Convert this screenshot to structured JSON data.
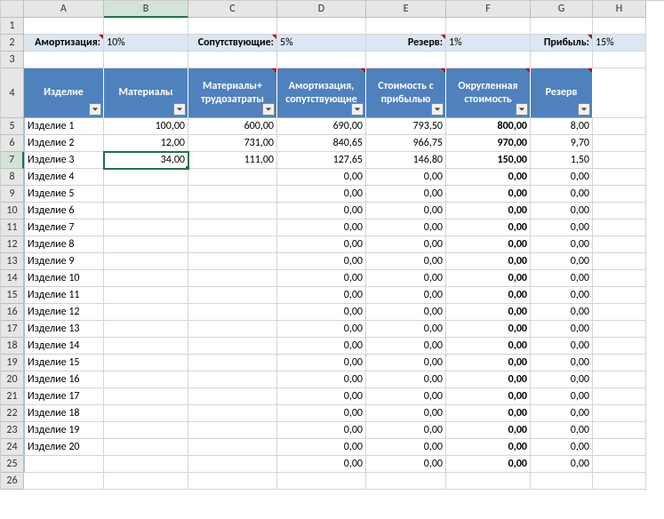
{
  "columns": [
    "A",
    "B",
    "C",
    "D",
    "E",
    "F",
    "G",
    "H"
  ],
  "active_col_index": 1,
  "params": {
    "amort_label": "Амортизация:",
    "amort_val": "10%",
    "sop_label": "Сопутствующие:",
    "sop_val": "5%",
    "rez_label": "Резерв:",
    "rez_val": "1%",
    "prib_label": "Прибыль:",
    "prib_val": "15%"
  },
  "headers": [
    "Изделие",
    "Материалы",
    "Материалы+ трудозатраты",
    "Амортизация, сопутствующие",
    "Стоимость с прибылью",
    "Округленная стоимость",
    "Резерв"
  ],
  "rows": [
    {
      "n": 5,
      "a": "Изделие 1",
      "b": "100,00",
      "c": "600,00",
      "d": "690,00",
      "e": "793,50",
      "f": "800,00",
      "g": "8,00"
    },
    {
      "n": 6,
      "a": "Изделие 2",
      "b": "12,00",
      "c": "731,00",
      "d": "840,65",
      "e": "966,75",
      "f": "970,00",
      "g": "9,70"
    },
    {
      "n": 7,
      "a": "Изделие 3",
      "b": "34,00",
      "c": "111,00",
      "d": "127,65",
      "e": "146,80",
      "f": "150,00",
      "g": "1,50",
      "active": true
    },
    {
      "n": 8,
      "a": "Изделие 4",
      "b": "",
      "c": "",
      "d": "0,00",
      "e": "0,00",
      "f": "0,00",
      "g": "0,00"
    },
    {
      "n": 9,
      "a": "Изделие 5",
      "b": "",
      "c": "",
      "d": "0,00",
      "e": "0,00",
      "f": "0,00",
      "g": "0,00"
    },
    {
      "n": 10,
      "a": "Изделие 6",
      "b": "",
      "c": "",
      "d": "0,00",
      "e": "0,00",
      "f": "0,00",
      "g": "0,00"
    },
    {
      "n": 11,
      "a": "Изделие 7",
      "b": "",
      "c": "",
      "d": "0,00",
      "e": "0,00",
      "f": "0,00",
      "g": "0,00"
    },
    {
      "n": 12,
      "a": "Изделие 8",
      "b": "",
      "c": "",
      "d": "0,00",
      "e": "0,00",
      "f": "0,00",
      "g": "0,00"
    },
    {
      "n": 13,
      "a": "Изделие 9",
      "b": "",
      "c": "",
      "d": "0,00",
      "e": "0,00",
      "f": "0,00",
      "g": "0,00"
    },
    {
      "n": 14,
      "a": "Изделие 10",
      "b": "",
      "c": "",
      "d": "0,00",
      "e": "0,00",
      "f": "0,00",
      "g": "0,00"
    },
    {
      "n": 15,
      "a": "Изделие 11",
      "b": "",
      "c": "",
      "d": "0,00",
      "e": "0,00",
      "f": "0,00",
      "g": "0,00"
    },
    {
      "n": 16,
      "a": "Изделие 12",
      "b": "",
      "c": "",
      "d": "0,00",
      "e": "0,00",
      "f": "0,00",
      "g": "0,00"
    },
    {
      "n": 17,
      "a": "Изделие 13",
      "b": "",
      "c": "",
      "d": "0,00",
      "e": "0,00",
      "f": "0,00",
      "g": "0,00"
    },
    {
      "n": 18,
      "a": "Изделие 14",
      "b": "",
      "c": "",
      "d": "0,00",
      "e": "0,00",
      "f": "0,00",
      "g": "0,00"
    },
    {
      "n": 19,
      "a": "Изделие 15",
      "b": "",
      "c": "",
      "d": "0,00",
      "e": "0,00",
      "f": "0,00",
      "g": "0,00"
    },
    {
      "n": 20,
      "a": "Изделие 16",
      "b": "",
      "c": "",
      "d": "0,00",
      "e": "0,00",
      "f": "0,00",
      "g": "0,00"
    },
    {
      "n": 21,
      "a": "Изделие 17",
      "b": "",
      "c": "",
      "d": "0,00",
      "e": "0,00",
      "f": "0,00",
      "g": "0,00"
    },
    {
      "n": 22,
      "a": "Изделие 18",
      "b": "",
      "c": "",
      "d": "0,00",
      "e": "0,00",
      "f": "0,00",
      "g": "0,00"
    },
    {
      "n": 23,
      "a": "Изделие 19",
      "b": "",
      "c": "",
      "d": "0,00",
      "e": "0,00",
      "f": "0,00",
      "g": "0,00"
    },
    {
      "n": 24,
      "a": "Изделие 20",
      "b": "",
      "c": "",
      "d": "0,00",
      "e": "0,00",
      "f": "0,00",
      "g": "0,00"
    },
    {
      "n": 25,
      "a": "",
      "b": "",
      "c": "",
      "d": "0,00",
      "e": "0,00",
      "f": "0,00",
      "g": "0,00"
    }
  ],
  "extra_rows": [
    26
  ]
}
